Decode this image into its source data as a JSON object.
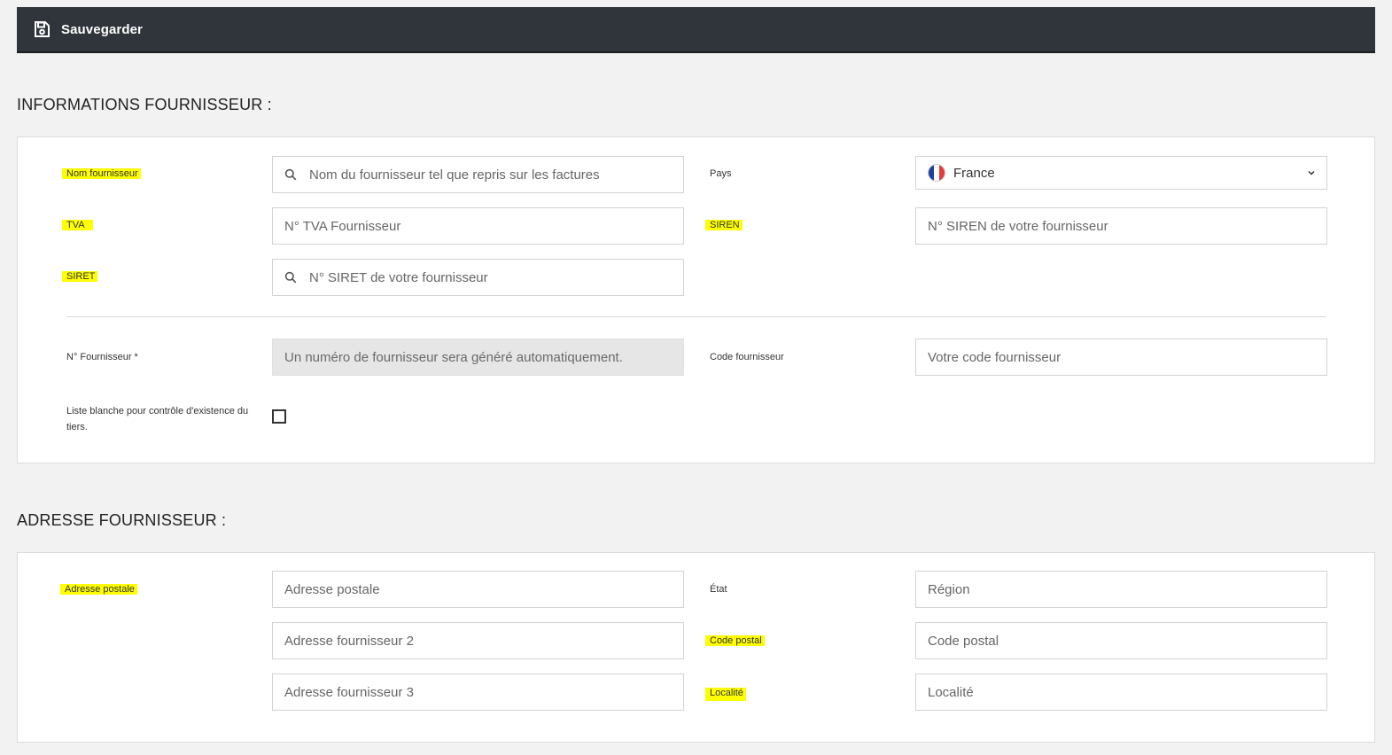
{
  "toolbar": {
    "save_label": "Sauvegarder"
  },
  "supplier_info": {
    "title": "INFORMATIONS FOURNISSEUR :",
    "nom_label": "Nom fournisseur",
    "nom_placeholder": "Nom du fournisseur tel que repris sur les factures",
    "pays_label": "Pays",
    "pays_value": "France",
    "tva_label": "TVA",
    "tva_placeholder": "N° TVA Fournisseur",
    "siren_label": "SIREN",
    "siren_placeholder": "N° SIREN de votre fournisseur",
    "siret_label": "SIRET",
    "siret_placeholder": "N° SIRET de votre fournisseur",
    "num_label": "N° Fournisseur *",
    "num_placeholder": "Un numéro de fournisseur sera généré automatiquement.",
    "code_label": "Code fournisseur",
    "code_placeholder": "Votre code fournisseur",
    "whitelist_label": "Liste blanche pour contrôle d'existence du tiers."
  },
  "address": {
    "title": "ADRESSE FOURNISSEUR :",
    "postale_label": "Adresse postale",
    "postale_placeholder": "Adresse postale",
    "addr2_placeholder": "Adresse fournisseur 2",
    "addr3_placeholder": "Adresse fournisseur 3",
    "etat_label": "État",
    "region_placeholder": "Région",
    "cp_label": "Code postal",
    "cp_placeholder": "Code postal",
    "localite_label": "Localité",
    "localite_placeholder": "Localité"
  },
  "colors": {
    "toolbar_bg": "#2f353a",
    "highlight": "#ffff00",
    "flag_blue": "#1f3f9c",
    "flag_red": "#e23b3b"
  },
  "icons": {
    "save": "floppy-disk-icon",
    "search": "search-icon",
    "chevron": "chevron-down-icon",
    "flag": "france-flag-icon"
  }
}
